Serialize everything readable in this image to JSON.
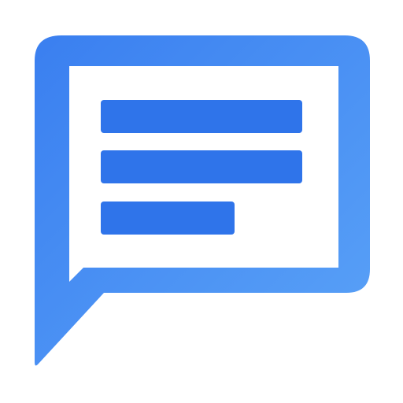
{
  "icon": {
    "name": "message-icon",
    "colors": {
      "bubble_start": "#3A7FF0",
      "bubble_end": "#5AA2F7",
      "line_fill": "#2F74EA",
      "interior": "#FFFFFF"
    }
  }
}
